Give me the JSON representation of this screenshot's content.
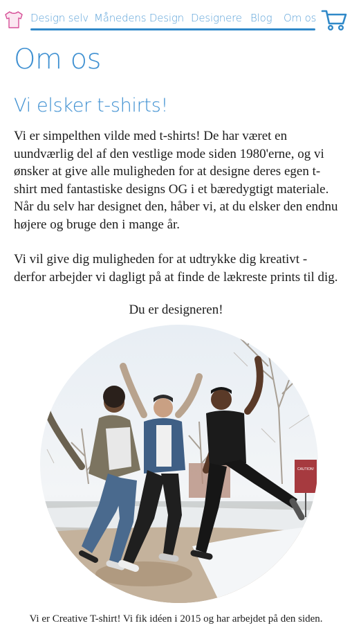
{
  "nav": {
    "logo_icon": "tshirt-icon",
    "links": [
      {
        "label": "Design selv"
      },
      {
        "label": "Månedens Design"
      },
      {
        "label": "Designere"
      },
      {
        "label": "Blog"
      },
      {
        "label": "Om os"
      }
    ],
    "cart_icon": "shopping-cart-icon",
    "accent_color": "#5aa1d8",
    "underline_color": "#2f88c8"
  },
  "page": {
    "title": "Om os",
    "section_title": "Vi elsker t-shirts!",
    "paragraphs": [
      "Vi er simpelthen vilde med t-shirts! De har været en uundværlig del af den vestlige mode siden 1980'erne, og vi ønsker at give alle muligheden for at designe deres egen t-shirt med fantastiske designs OG i et bæredygtigt materiale. Når du selv har designet den, håber vi, at du elsker den endnu højere og bruge den i mange år.",
      "Vi vil give dig muligheden for at udtrykke dig kreativt - derfor arbejder vi dagligt på at finde de lækreste prints til dig."
    ],
    "tagline": "Du er designeren!",
    "photo_sign": "CAUTION!",
    "caption": "Vi er Creative T-shirt! Vi fik idéen i 2015 og har arbejdet på den siden.",
    "heading_color": "#3d8fd1"
  }
}
